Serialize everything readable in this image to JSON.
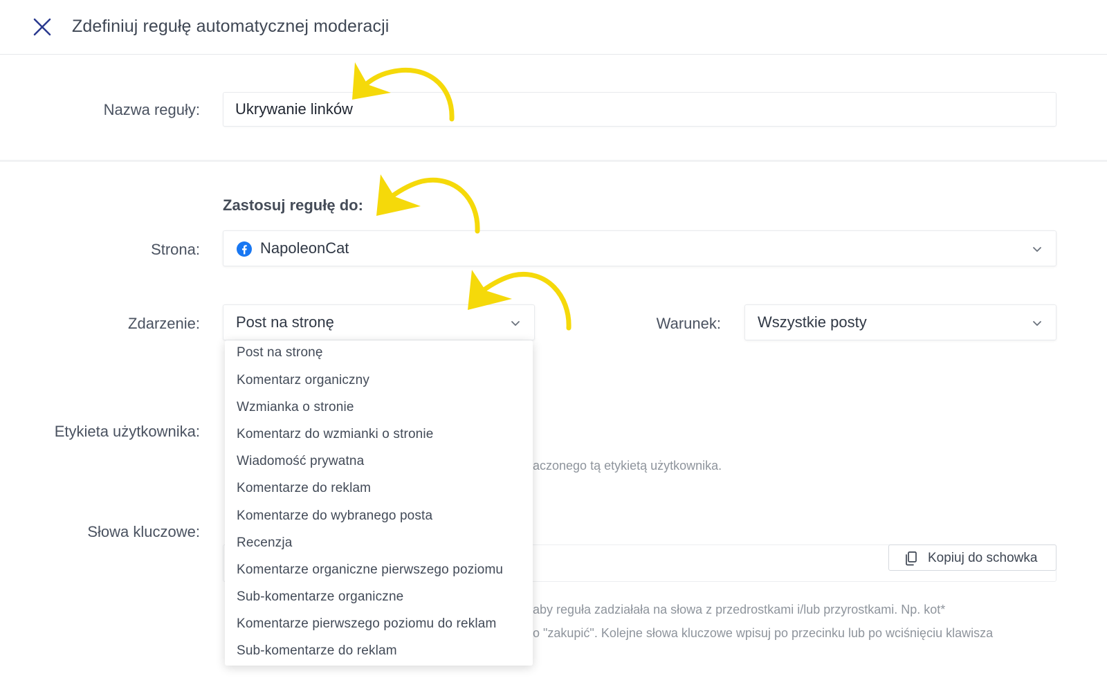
{
  "header": {
    "title": "Zdefiniuj regułę automatycznej moderacji",
    "close_icon": "close-icon"
  },
  "rule_name": {
    "label": "Nazwa reguły:",
    "value": "Ukrywanie linków"
  },
  "apply_to": {
    "heading": "Zastosuj regułę do:"
  },
  "page": {
    "label": "Strona:",
    "value": "NapoleonCat",
    "icon": "facebook-icon"
  },
  "event": {
    "label": "Zdarzenie:",
    "value": "Post na stronę",
    "options": [
      "Post na stronę",
      "Komentarz organiczny",
      "Wzmianka o stronie",
      "Komentarz do wzmianki o stronie",
      "Wiadomość prywatna",
      "Komentarze do reklam",
      "Komentarze do wybranego posta",
      "Recenzja",
      "Komentarze organiczne pierwszego poziomu",
      "Sub-komentarze organiczne",
      "Komentarze pierwszego poziomu do reklam",
      "Sub-komentarze do reklam"
    ]
  },
  "condition": {
    "label": "Warunek:",
    "value": "Wszystkie posty"
  },
  "user_tag": {
    "label": "Etykieta użytkownika:",
    "helper": "aczonego tą etykietą użytkownika."
  },
  "keywords": {
    "label": "Słowa kluczowe:",
    "copy_label": "Kopiuj do schowka",
    "copy_icon": "copy-icon",
    "helper_line1": "aby reguła zadziałała na słowa z przedrostkami i/lub przyrostkami. Np. kot*",
    "helper_line2": "o \"zakupić\". Kolejne słowa kluczowe wpisuj po przecinku lub po wciśnięciu klawisza"
  },
  "annotations": {
    "arrow_color": "#f5d90a",
    "arrow_icon": "curved-arrow-icon"
  },
  "colors": {
    "close_icon": "#2b3a8f",
    "facebook": "#1877f2"
  }
}
